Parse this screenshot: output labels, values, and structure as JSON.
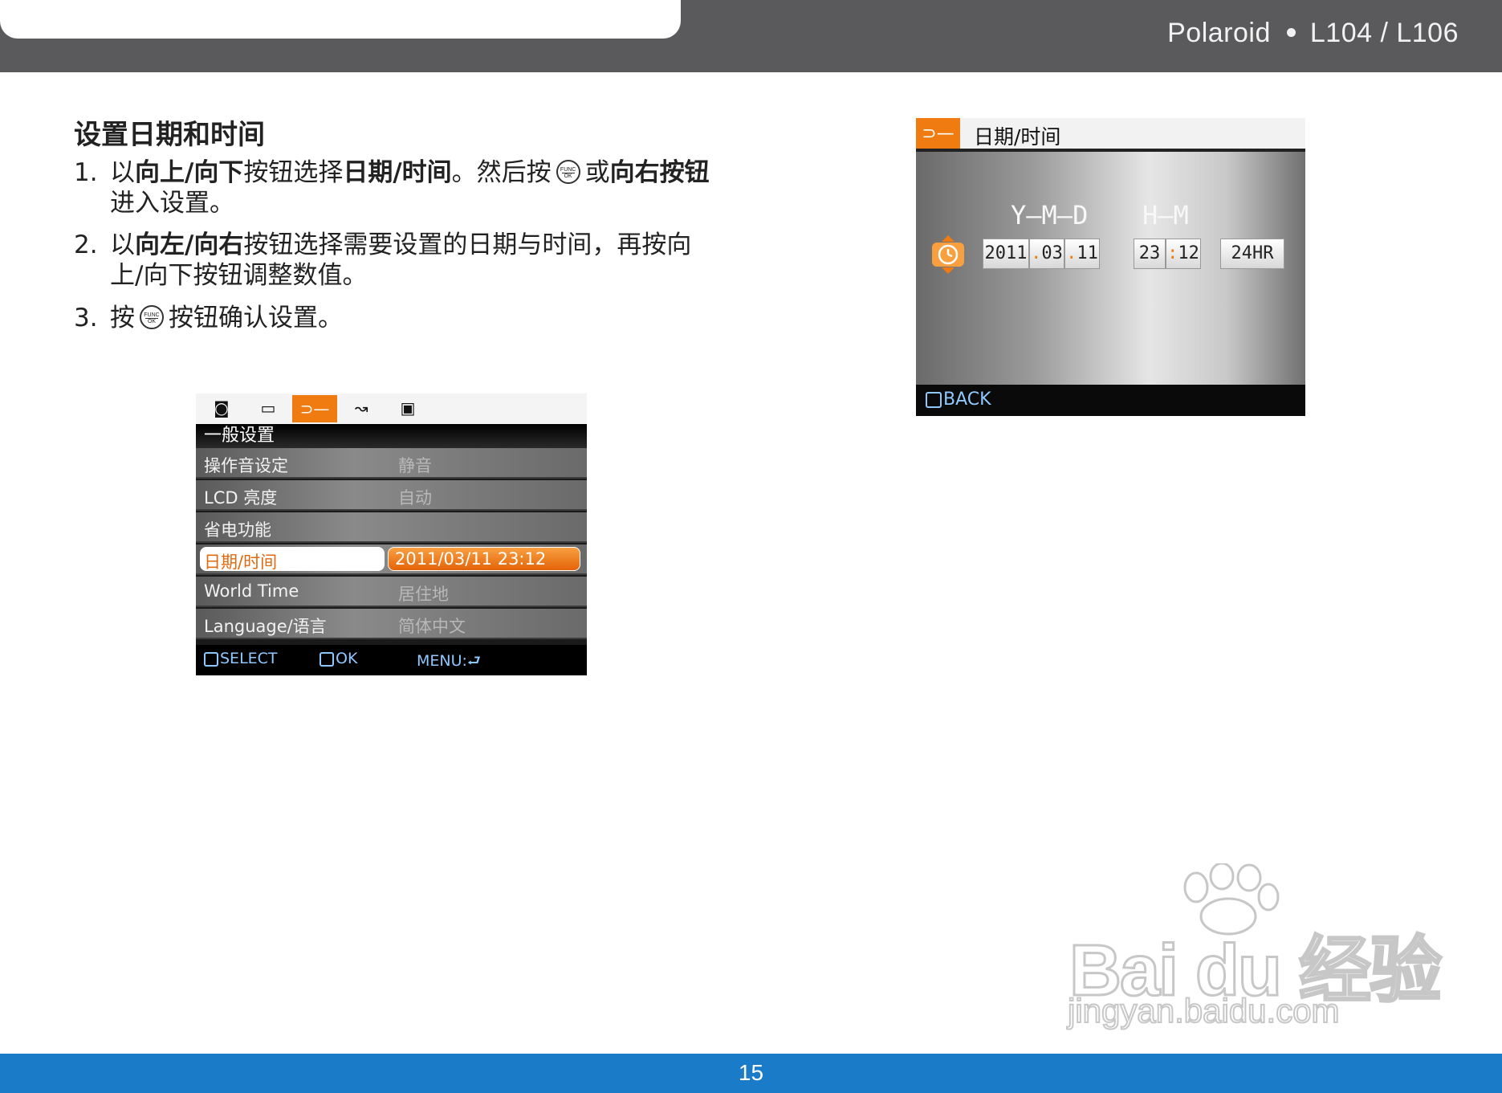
{
  "header": {
    "brand": "Polaroid",
    "model": "L104 / L106"
  },
  "section": {
    "title": "设置日期和时间"
  },
  "steps": [
    {
      "num": "1.",
      "parts": [
        {
          "t": "以"
        },
        {
          "t": "向上/向下",
          "b": true
        },
        {
          "t": "按钮选择"
        },
        {
          "t": "日期/时间",
          "b": true
        },
        {
          "t": "。然后按"
        },
        {
          "icon": "func-ok"
        },
        {
          "t": "或"
        },
        {
          "t": "向右按钮",
          "b": true
        },
        {
          "t": "进入设置。"
        }
      ]
    },
    {
      "num": "2.",
      "parts": [
        {
          "t": "以"
        },
        {
          "t": "向左/向右",
          "b": true
        },
        {
          "t": "按钮选择需要设置的日期与时间，再按向上/向下按钮调整数值。"
        }
      ]
    },
    {
      "num": "3.",
      "parts": [
        {
          "t": "按"
        },
        {
          "icon": "func-ok"
        },
        {
          "t": "按钮确认设置。"
        }
      ]
    }
  ],
  "func_icon": {
    "top": "FUNC",
    "bottom": "OK"
  },
  "menu_screen": {
    "tabs": [
      {
        "icon": "camera-icon",
        "glyph": "◙"
      },
      {
        "icon": "movie-icon",
        "glyph": "▭"
      },
      {
        "icon": "setup-wrench-icon",
        "glyph": "⊃—",
        "active": true
      },
      {
        "icon": "transfer-icon",
        "glyph": "↝"
      },
      {
        "icon": "print-icon",
        "glyph": "▣"
      }
    ],
    "heading": "一般设置",
    "rows": [
      {
        "label": "操作音设定",
        "value": "静音"
      },
      {
        "label": "LCD 亮度",
        "value": "自动"
      },
      {
        "label": "省电功能",
        "value": ""
      },
      {
        "label": "日期/时间",
        "value": "2011/03/11 23:12",
        "selected": true
      },
      {
        "label": "World Time",
        "value": "居住地"
      },
      {
        "label": "Language/语言",
        "value": "简体中文"
      }
    ],
    "bar": {
      "select": "SELECT",
      "ok": "OK",
      "menu": "MENU:"
    }
  },
  "date_screen": {
    "title": "日期/时间",
    "ymd_label": "Y—M—D",
    "hm_label": "H—M",
    "year": "2011",
    "month": "03",
    "day": "11",
    "hour": "23",
    "minute": "12",
    "format": "24HR",
    "back": "BACK"
  },
  "watermark": {
    "brand": "Bai du 经验",
    "url": "jingyan.baidu.com"
  },
  "footer": {
    "page_number": "15"
  },
  "colors": {
    "header_bg": "#5a5a5c",
    "footer_bg": "#1a7cc9",
    "accent_orange": "#f07b10"
  }
}
